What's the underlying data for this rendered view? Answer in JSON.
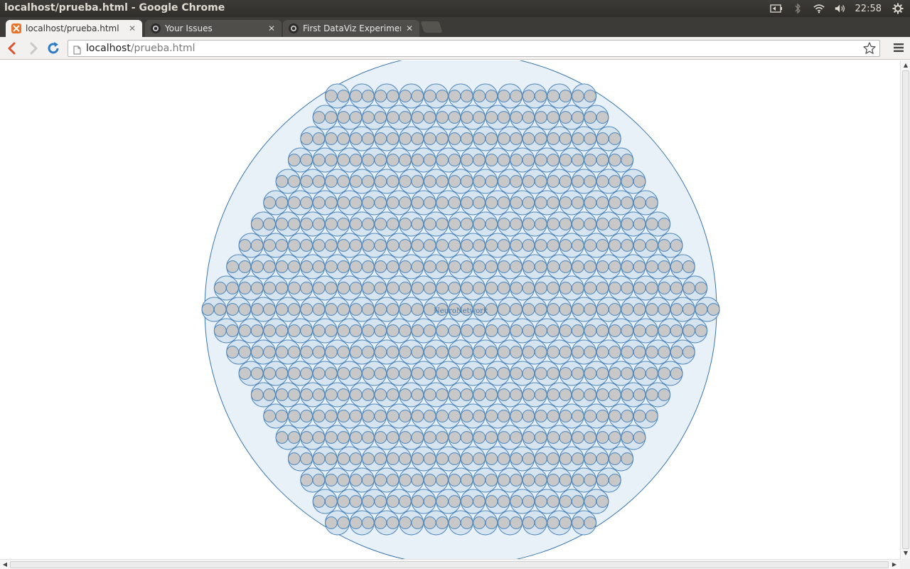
{
  "window": {
    "title": "localhost/prueba.html - Google Chrome",
    "clock": "22:58"
  },
  "tray_icons": [
    "battery-icon",
    "bluetooth-icon",
    "wifi-icon",
    "volume-icon",
    "settings-gear-icon"
  ],
  "tabs": [
    {
      "label": "localhost/prueba.html",
      "active": true,
      "favicon": "xampp-icon"
    },
    {
      "label": "Your Issues",
      "active": false,
      "favicon": "github-icon"
    },
    {
      "label": "First DataViz Experiment",
      "active": false,
      "favicon": "github-icon"
    }
  ],
  "omnibox": {
    "host": "localhost",
    "path": "/prueba.html"
  },
  "content": {
    "center_label": "NeuroNetwork",
    "colors": {
      "outer_fill": "#e8f0f8",
      "outer_stroke": "#3a77b0",
      "group_fill": "#d6e4f0",
      "leaf_fill": "#c8c8c8",
      "leaf_stroke": "#4b85bd",
      "label": "#3a77b0"
    }
  }
}
